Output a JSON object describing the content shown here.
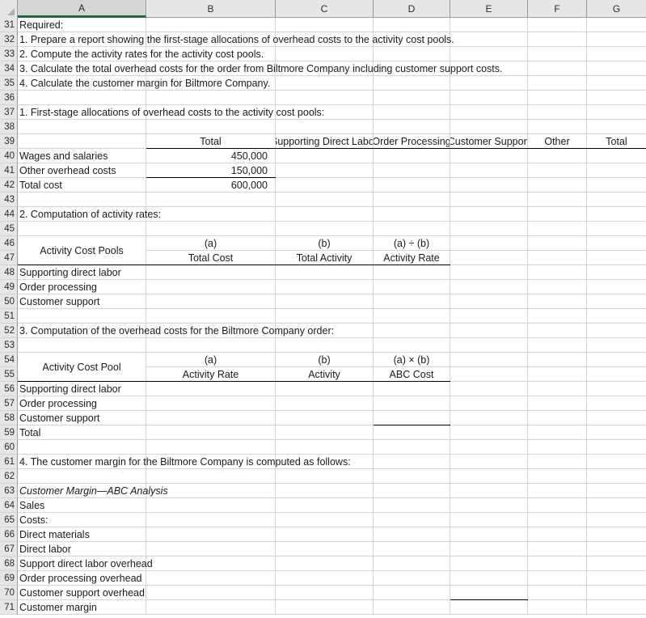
{
  "sheet": {
    "columns": [
      "A",
      "B",
      "C",
      "D",
      "E",
      "F",
      "G"
    ],
    "selected_column": "A",
    "first_row": 31,
    "last_row": 71,
    "row_numbers": [
      31,
      32,
      33,
      34,
      35,
      36,
      37,
      38,
      39,
      40,
      41,
      42,
      43,
      44,
      45,
      46,
      47,
      48,
      49,
      50,
      51,
      52,
      53,
      54,
      55,
      56,
      57,
      58,
      59,
      60,
      61,
      62,
      63,
      64,
      65,
      66,
      67,
      68,
      69,
      70,
      71
    ],
    "select_all_icon": "select-all-triangle-icon"
  },
  "cells": {
    "r31": {
      "a": "Required:"
    },
    "r32": {
      "a": "1. Prepare a report showing the first-stage allocations of overhead costs to the activity cost pools."
    },
    "r33": {
      "a": "2. Compute the activity rates for the activity cost pools."
    },
    "r34": {
      "a": "3. Calculate the total overhead costs for the order from Biltmore Company including customer support costs."
    },
    "r35": {
      "a": "4. Calculate the customer margin for Biltmore Company."
    },
    "r37": {
      "a": "1. First-stage allocations of overhead costs to the activity cost pools:"
    },
    "r39": {
      "b": "Total",
      "c": "Supporting Direct Labor",
      "d": "Order Processing",
      "e": "Customer Support",
      "f": "Other",
      "g": "Total"
    },
    "r40": {
      "a": "Wages and salaries",
      "b": "450,000"
    },
    "r41": {
      "a": "Other overhead costs",
      "b": "150,000"
    },
    "r42": {
      "a": "Total cost",
      "b": "600,000"
    },
    "r44": {
      "a": "2. Computation of activity rates:"
    },
    "r46": {
      "a": "Activity Cost Pools",
      "b": "(a)",
      "c": "(b)",
      "d": "(a) ÷ (b)"
    },
    "r47": {
      "b": "Total Cost",
      "c": "Total Activity",
      "d": "Activity Rate"
    },
    "r48": {
      "a": "Supporting direct labor"
    },
    "r49": {
      "a": "Order processing"
    },
    "r50": {
      "a": "Customer support"
    },
    "r52": {
      "a": "3. Computation of the overhead costs for the Biltmore Company order:"
    },
    "r54": {
      "a": "Activity Cost Pool",
      "b": "(a)",
      "c": "(b)",
      "d": "(a) × (b)"
    },
    "r55": {
      "b": "Activity Rate",
      "c": "Activity",
      "d": "ABC Cost"
    },
    "r56": {
      "a": "Supporting direct labor"
    },
    "r57": {
      "a": "Order processing"
    },
    "r58": {
      "a": "Customer support"
    },
    "r59": {
      "a": "Total"
    },
    "r61": {
      "a": "4. The customer margin for the Biltmore Company is computed as follows:"
    },
    "r63": {
      "a": "Customer Margin—ABC Analysis"
    },
    "r64": {
      "a": "Sales"
    },
    "r65": {
      "a": "Costs:"
    },
    "r66": {
      "a": "Direct materials"
    },
    "r67": {
      "a": "Direct labor"
    },
    "r68": {
      "a": "Support direct labor overhead"
    },
    "r69": {
      "a": "Order processing overhead"
    },
    "r70": {
      "a": "Customer support overhead"
    },
    "r71": {
      "a": "Customer margin"
    }
  }
}
